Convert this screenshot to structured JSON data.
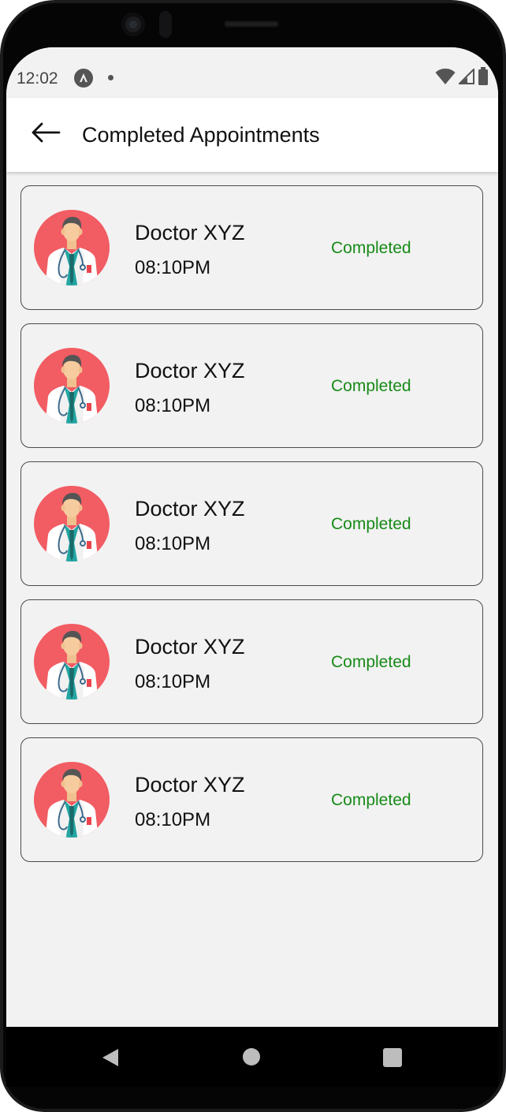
{
  "status_bar": {
    "time": "12:02"
  },
  "header": {
    "title": "Completed Appointments"
  },
  "appointments": [
    {
      "doctor": "Doctor XYZ",
      "time": "08:10PM",
      "status": "Completed"
    },
    {
      "doctor": "Doctor XYZ",
      "time": "08:10PM",
      "status": "Completed"
    },
    {
      "doctor": "Doctor XYZ",
      "time": "08:10PM",
      "status": "Completed"
    },
    {
      "doctor": "Doctor XYZ",
      "time": "08:10PM",
      "status": "Completed"
    },
    {
      "doctor": "Doctor XYZ",
      "time": "08:10PM",
      "status": "Completed"
    }
  ],
  "colors": {
    "status_completed": "#178a17",
    "avatar_background": "#f25c63",
    "screen_background": "#f2f2f2"
  },
  "icons": {
    "back": "arrow-left-icon",
    "avatar": "doctor-avatar-icon"
  }
}
